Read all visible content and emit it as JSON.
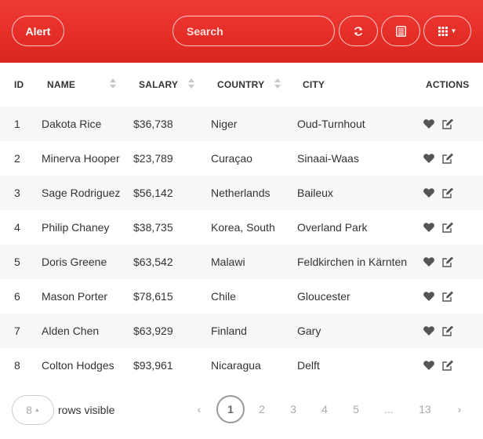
{
  "toolbar": {
    "alert_label": "Alert",
    "search_placeholder": "Search",
    "search_value": "",
    "accent_color": "#e52d27"
  },
  "table": {
    "columns": [
      {
        "label": "ID",
        "sortable": false
      },
      {
        "label": "Name",
        "sortable": true
      },
      {
        "label": "Salary",
        "sortable": true
      },
      {
        "label": "Country",
        "sortable": true
      },
      {
        "label": "City",
        "sortable": false
      },
      {
        "label": "Actions",
        "sortable": false
      }
    ],
    "rows": [
      {
        "id": "1",
        "name": "Dakota Rice",
        "salary": "$36,738",
        "country": "Niger",
        "city": "Oud-Turnhout"
      },
      {
        "id": "2",
        "name": "Minerva Hooper",
        "salary": "$23,789",
        "country": "Curaçao",
        "city": "Sinaai-Waas"
      },
      {
        "id": "3",
        "name": "Sage Rodriguez",
        "salary": "$56,142",
        "country": "Netherlands",
        "city": "Baileux"
      },
      {
        "id": "4",
        "name": "Philip Chaney",
        "salary": "$38,735",
        "country": "Korea, South",
        "city": "Overland Park"
      },
      {
        "id": "5",
        "name": "Doris Greene",
        "salary": "$63,542",
        "country": "Malawi",
        "city": "Feldkirchen in Kärnten"
      },
      {
        "id": "6",
        "name": "Mason Porter",
        "salary": "$78,615",
        "country": "Chile",
        "city": "Gloucester"
      },
      {
        "id": "7",
        "name": "Alden Chen",
        "salary": "$63,929",
        "country": "Finland",
        "city": "Gary"
      },
      {
        "id": "8",
        "name": "Colton Hodges",
        "salary": "$93,961",
        "country": "Nicaragua",
        "city": "Delft"
      }
    ],
    "row_actions": [
      "heart-icon",
      "edit-icon"
    ]
  },
  "footer": {
    "rows_per_page": "8",
    "rows_label": "rows visible",
    "pagination": {
      "prev": "‹",
      "pages": [
        "1",
        "2",
        "3",
        "4",
        "5",
        "...",
        "13"
      ],
      "active": "1",
      "next": "›"
    }
  }
}
